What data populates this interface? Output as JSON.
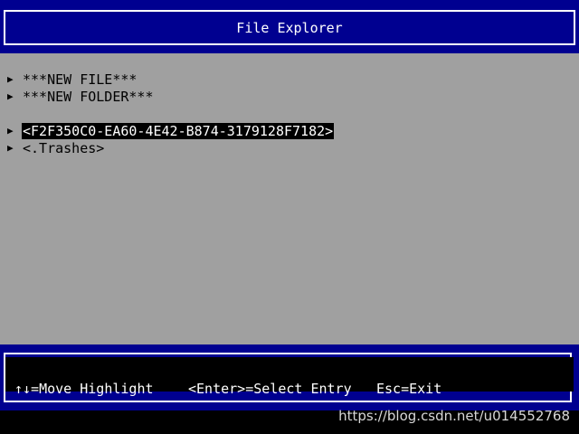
{
  "header": {
    "title": "File Explorer"
  },
  "entries": [
    {
      "label": "***NEW FILE***",
      "icon": "triangle-right-icon"
    },
    {
      "label": "***NEW FOLDER***",
      "icon": "triangle-right-icon"
    },
    {
      "label": "<F2F350C0-EA60-4E42-B874-3179128F7182>",
      "icon": "triangle-right-icon",
      "selected": true
    },
    {
      "label": "<.Trashes>",
      "icon": "triangle-right-icon"
    }
  ],
  "footer": {
    "hint_move": "↑↓=Move Highlight",
    "hint_select": "<Enter>=Select Entry",
    "hint_exit": "Esc=Exit"
  },
  "watermark": "https://blog.csdn.net/u014552768",
  "colors": {
    "header_bg": "#000090",
    "content_bg": "#a0a0a0",
    "highlight_bg": "#000000",
    "highlight_fg": "#ffffff"
  }
}
